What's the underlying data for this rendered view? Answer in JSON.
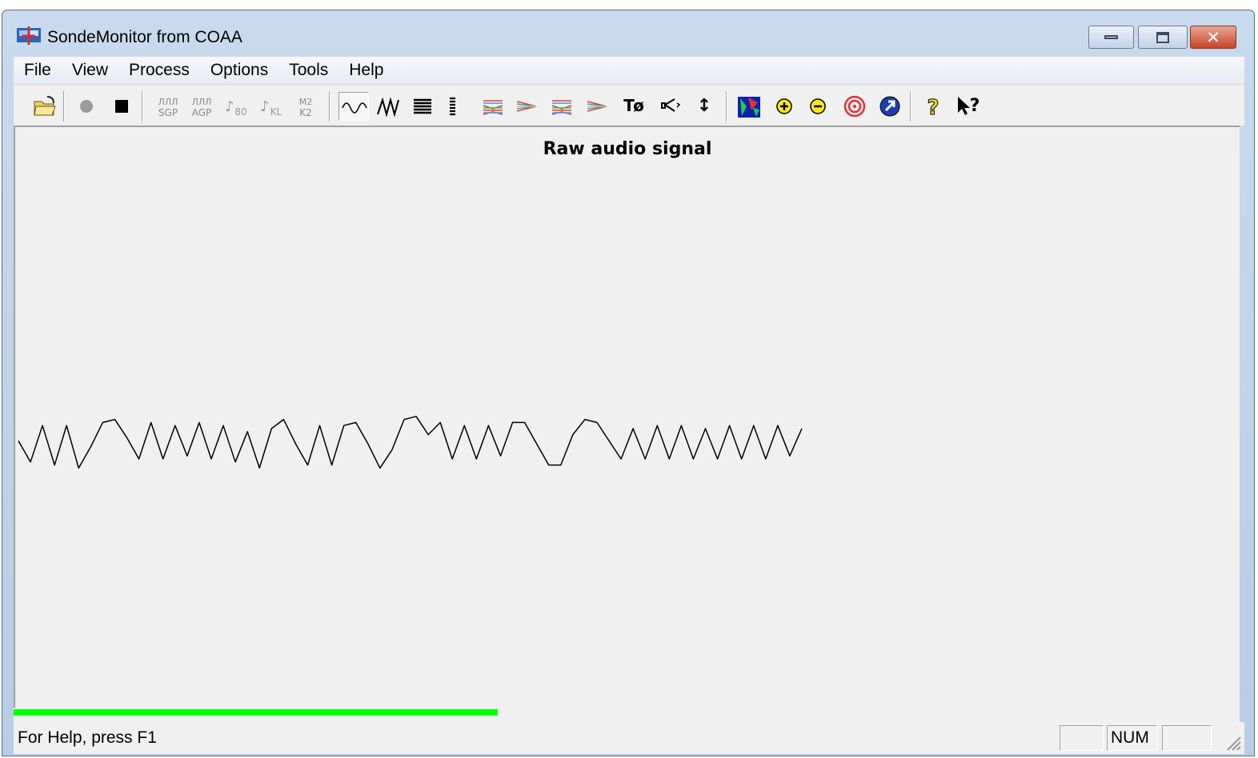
{
  "window": {
    "title": "SondeMonitor from COAA",
    "close_glyph": "✕"
  },
  "menubar": {
    "items": [
      "File",
      "View",
      "Process",
      "Options",
      "Tools",
      "Help"
    ]
  },
  "toolbar": {
    "buttons": [
      {
        "name": "open-icon"
      },
      {
        "name": "record-icon"
      },
      {
        "name": "stop-icon"
      },
      {
        "name": "sgp-icon",
        "top": "ЛЛЛ",
        "bottom": "SGP"
      },
      {
        "name": "agp-icon",
        "top": "ЛЛЛ",
        "bottom": "AGP"
      },
      {
        "name": "note-80-icon",
        "text": "80"
      },
      {
        "name": "note-kl-icon",
        "text": "KL"
      },
      {
        "name": "m2k2-icon",
        "top": "M2",
        "bottom": "K2"
      },
      {
        "name": "sine-wave-icon",
        "pressed": true
      },
      {
        "name": "filtered-wave-icon"
      },
      {
        "name": "bars-icon"
      },
      {
        "name": "narrow-bars-icon"
      },
      {
        "name": "multi-trace-1-icon"
      },
      {
        "name": "multi-trace-2-icon"
      },
      {
        "name": "multi-trace-3-icon"
      },
      {
        "name": "multi-trace-4-icon"
      },
      {
        "name": "t-zero-icon",
        "text": "Tø"
      },
      {
        "name": "speaker-icon"
      },
      {
        "name": "vertical-arrows-icon",
        "text": "↕"
      },
      {
        "name": "map-icon"
      },
      {
        "name": "zoom-in-icon"
      },
      {
        "name": "zoom-out-icon"
      },
      {
        "name": "target-icon"
      },
      {
        "name": "navigate-icon"
      },
      {
        "name": "help-icon",
        "text": "?"
      },
      {
        "name": "context-help-icon",
        "text": "?"
      }
    ]
  },
  "chart_data": {
    "type": "line",
    "title": "Raw audio signal",
    "y": [
      0.1,
      -0.6,
      0.6,
      -0.7,
      0.6,
      -0.8,
      -0.1,
      0.7,
      0.8,
      0.2,
      -0.5,
      0.7,
      -0.5,
      0.6,
      -0.4,
      0.7,
      -0.5,
      0.6,
      -0.6,
      0.4,
      -0.8,
      0.5,
      0.8,
      0.0,
      -0.7,
      0.6,
      -0.7,
      0.6,
      0.7,
      0.0,
      -0.8,
      -0.2,
      0.8,
      0.9,
      0.3,
      0.7,
      -0.5,
      0.6,
      -0.5,
      0.6,
      -0.4,
      0.7,
      0.7,
      0.0,
      -0.7,
      -0.7,
      0.3,
      0.8,
      0.7,
      0.1,
      -0.5,
      0.5,
      -0.5,
      0.6,
      -0.5,
      0.6,
      -0.5,
      0.5,
      -0.5,
      0.6,
      -0.5,
      0.6,
      -0.5,
      0.6,
      -0.4,
      0.5
    ],
    "color": "#000000"
  },
  "progress": {
    "value": 0.395,
    "color": "#00ff00"
  },
  "statusbar": {
    "help_text": "For Help, press F1",
    "panels": [
      "",
      "NUM",
      ""
    ]
  }
}
